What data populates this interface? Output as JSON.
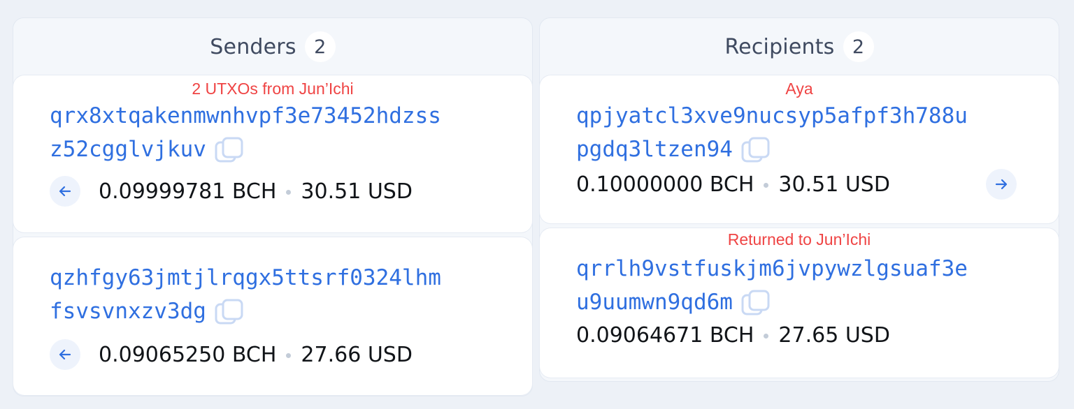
{
  "senders": {
    "title": "Senders",
    "count": "2",
    "items": [
      {
        "note": "2 UTXOs from Jun’Ichi",
        "address_line1": "qrx8xtqakenmwnhvpf3e73452hdzss",
        "address_line2": "z52cgglvjkuv",
        "bch": "0.09999781 BCH",
        "usd": "30.51 USD"
      },
      {
        "note": "",
        "address_line1": "qzhfgy63jmtjlrqgx5ttsrf0324lhm",
        "address_line2": "fsvsvnxzv3dg",
        "bch": "0.09065250 BCH",
        "usd": "27.66 USD"
      }
    ]
  },
  "recipients": {
    "title": "Recipients",
    "count": "2",
    "items": [
      {
        "note": "Aya",
        "address_line1": "qpjyatcl3xve9nucsyp5afpf3h788u",
        "address_line2": "pgdq3ltzen94",
        "bch": "0.10000000 BCH",
        "usd": "30.51 USD"
      },
      {
        "note": "Returned to Jun’Ichi",
        "address_line1": "qrrlh9vstfuskjm6jvpywzlgsuaf3e",
        "address_line2": "u9uumwn9qd6m",
        "bch": "0.09064671 BCH",
        "usd": "27.65 USD"
      }
    ]
  },
  "colors": {
    "address": "#2f6fe0",
    "note": "#ef4444",
    "background": "#edf1f7"
  },
  "icons": {
    "copy": "copy-icon",
    "input_arrow": "arrow-left-icon",
    "output_arrow": "arrow-right-icon"
  }
}
